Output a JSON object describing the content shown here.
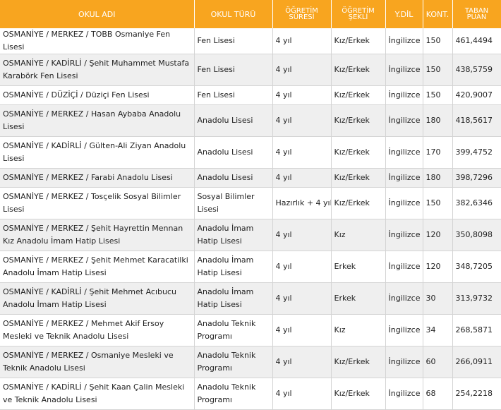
{
  "headers": {
    "school_name": "OKUL ADI",
    "school_type": "OKUL TÜRÜ",
    "duration_line1": "ÖĞRETİM",
    "duration_line2": "SÜRESİ",
    "form_line1": "ÖĞRETİM",
    "form_line2": "ŞEKLİ",
    "language": "Y.DİL",
    "quota": "KONT.",
    "score_line1": "TABAN",
    "score_line2": "PUAN"
  },
  "rows": [
    {
      "name": "OSMANİYE / MERKEZ / TOBB Osmaniye Fen Lisesi",
      "type": "Fen Lisesi",
      "duration": "4 yıl",
      "form": "Kız/Erkek",
      "language": "İngilizce",
      "quota": "150",
      "score": "461,4494"
    },
    {
      "name": "OSMANİYE / KADİRLİ / Şehit Muhammet Mustafa Karabörk Fen Lisesi",
      "type": "Fen Lisesi",
      "duration": "4 yıl",
      "form": "Kız/Erkek",
      "language": "İngilizce",
      "quota": "150",
      "score": "438,5759"
    },
    {
      "name": "OSMANİYE / DÜZİÇİ / Düziçi Fen Lisesi",
      "type": "Fen Lisesi",
      "duration": "4 yıl",
      "form": "Kız/Erkek",
      "language": "İngilizce",
      "quota": "150",
      "score": "420,9007"
    },
    {
      "name": "OSMANİYE / MERKEZ / Hasan Aybaba Anadolu Lisesi",
      "type": "Anadolu Lisesi",
      "duration": "4 yıl",
      "form": "Kız/Erkek",
      "language": "İngilizce",
      "quota": "180",
      "score": "418,5617"
    },
    {
      "name": "OSMANİYE / KADİRLİ / Gülten-Ali Ziyan Anadolu Lisesi",
      "type": "Anadolu Lisesi",
      "duration": "4 yıl",
      "form": "Kız/Erkek",
      "language": "İngilizce",
      "quota": "170",
      "score": "399,4752"
    },
    {
      "name": "OSMANİYE / MERKEZ / Farabi Anadolu Lisesi",
      "type": "Anadolu Lisesi",
      "duration": "4 yıl",
      "form": "Kız/Erkek",
      "language": "İngilizce",
      "quota": "180",
      "score": "398,7296"
    },
    {
      "name": "OSMANİYE / MERKEZ / Tosçelik Sosyal Bilimler Lisesi",
      "type": "Sosyal Bilimler Lisesi",
      "duration": "Hazırlık + 4 yıl",
      "form": "Kız/Erkek",
      "language": "İngilizce",
      "quota": "150",
      "score": "382,6346"
    },
    {
      "name": "OSMANİYE / MERKEZ / Şehit Hayrettin Mennan Kız Anadolu İmam Hatip Lisesi",
      "type": "Anadolu İmam Hatip Lisesi",
      "duration": "4 yıl",
      "form": "Kız",
      "language": "İngilizce",
      "quota": "120",
      "score": "350,8098"
    },
    {
      "name": "OSMANİYE / MERKEZ / Şehit Mehmet Karacatilki Anadolu İmam Hatip Lisesi",
      "type": "Anadolu İmam Hatip Lisesi",
      "duration": "4 yıl",
      "form": "Erkek",
      "language": "İngilizce",
      "quota": "120",
      "score": "348,7205"
    },
    {
      "name": "OSMANİYE / KADİRLİ / Şehit Mehmet Acıbucu Anadolu İmam Hatip Lisesi",
      "type": "Anadolu İmam Hatip Lisesi",
      "duration": "4 yıl",
      "form": "Erkek",
      "language": "İngilizce",
      "quota": "30",
      "score": "313,9732"
    },
    {
      "name": "OSMANİYE / MERKEZ / Mehmet Akif Ersoy Mesleki ve Teknik Anadolu Lisesi",
      "type": "Anadolu Teknik Programı",
      "duration": "4 yıl",
      "form": "Kız",
      "language": "İngilizce",
      "quota": "34",
      "score": "268,5871"
    },
    {
      "name": "OSMANİYE / MERKEZ / Osmaniye Mesleki ve Teknik Anadolu Lisesi",
      "type": "Anadolu Teknik Programı",
      "duration": "4 yıl",
      "form": "Kız/Erkek",
      "language": "İngilizce",
      "quota": "60",
      "score": "266,0911"
    },
    {
      "name": "OSMANİYE / KADİRLİ / Şehit Kaan Çalin Mesleki ve Teknik Anadolu Lisesi",
      "type": "Anadolu Teknik Programı",
      "duration": "4 yıl",
      "form": "Kız/Erkek",
      "language": "İngilizce",
      "quota": "68",
      "score": "254,2218"
    }
  ]
}
